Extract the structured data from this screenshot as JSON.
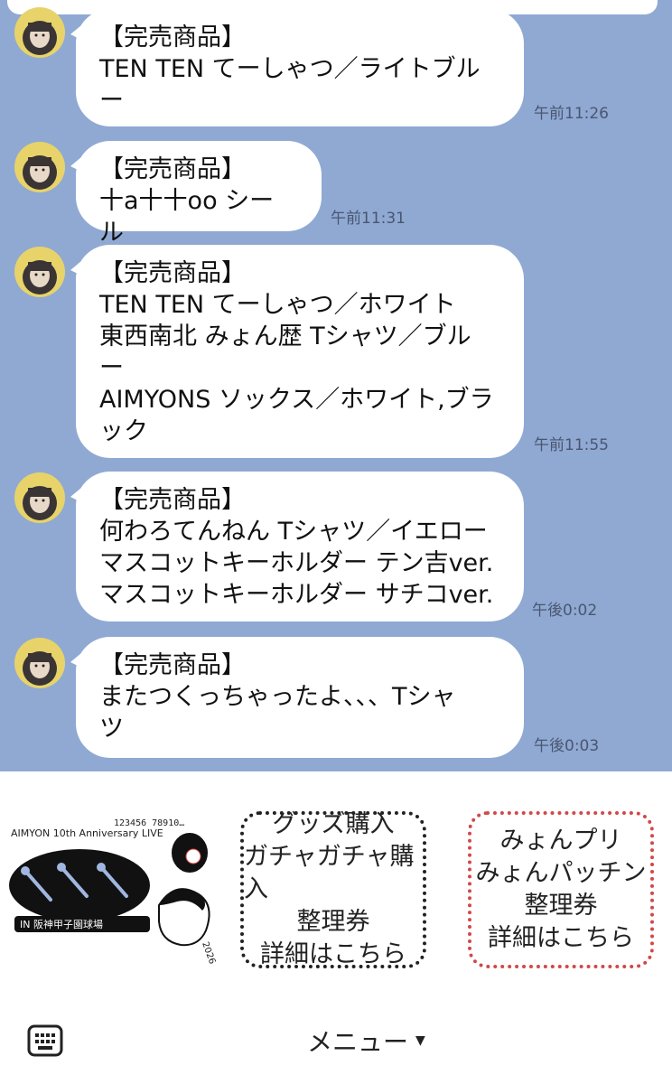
{
  "messages": [
    {
      "lines": "【完売商品】\nTEN TEN てーしゃつ／ライトブル\nー",
      "time": "午前11:26"
    },
    {
      "lines": "【完売商品】\n十a十十oo シール",
      "time": "午前11:31"
    },
    {
      "lines": "【完売商品】\nTEN TEN てーしゃつ／ホワイト\n東西南北 みょん歴 Tシャツ／ブル\nー\nAIMYONS ソックス／ホワイト,ブラ\nック",
      "time": "午前11:55"
    },
    {
      "lines": "【完売商品】\n何わろてんねん Tシャツ／イエロー\nマスコットキーホルダー テン吉ver.\nマスコットキーホルダー サチコver.",
      "time": "午後0:02"
    },
    {
      "lines": "【完売商品】\nまたつくっちゃったよ、、、Tシャ\nツ",
      "time": "午後0:03"
    }
  ],
  "rich_menu": {
    "art": {
      "title": "AIMYON 10th Anniversary LIVE",
      "venue": "IN 阪神甲子園球場",
      "numbers": "123456 78910…",
      "year": "2026"
    },
    "goods": {
      "line1": "グッズ購入",
      "line2": "ガチャガチャ購入",
      "line3": "整理券",
      "line4": "詳細はこちら"
    },
    "myon": {
      "line1": "みょんプリ",
      "line2": "みょんパッチン",
      "line3": "整理券",
      "line4": "詳細はこちら"
    }
  },
  "bottom_bar": {
    "menu_label": "メニュー",
    "keyboard_icon": "keyboard-icon",
    "caret_icon": "caret-down-icon"
  },
  "colors": {
    "chat_bg": "#8fa9d3",
    "bubble": "#ffffff",
    "myon_border": "#d24848"
  }
}
